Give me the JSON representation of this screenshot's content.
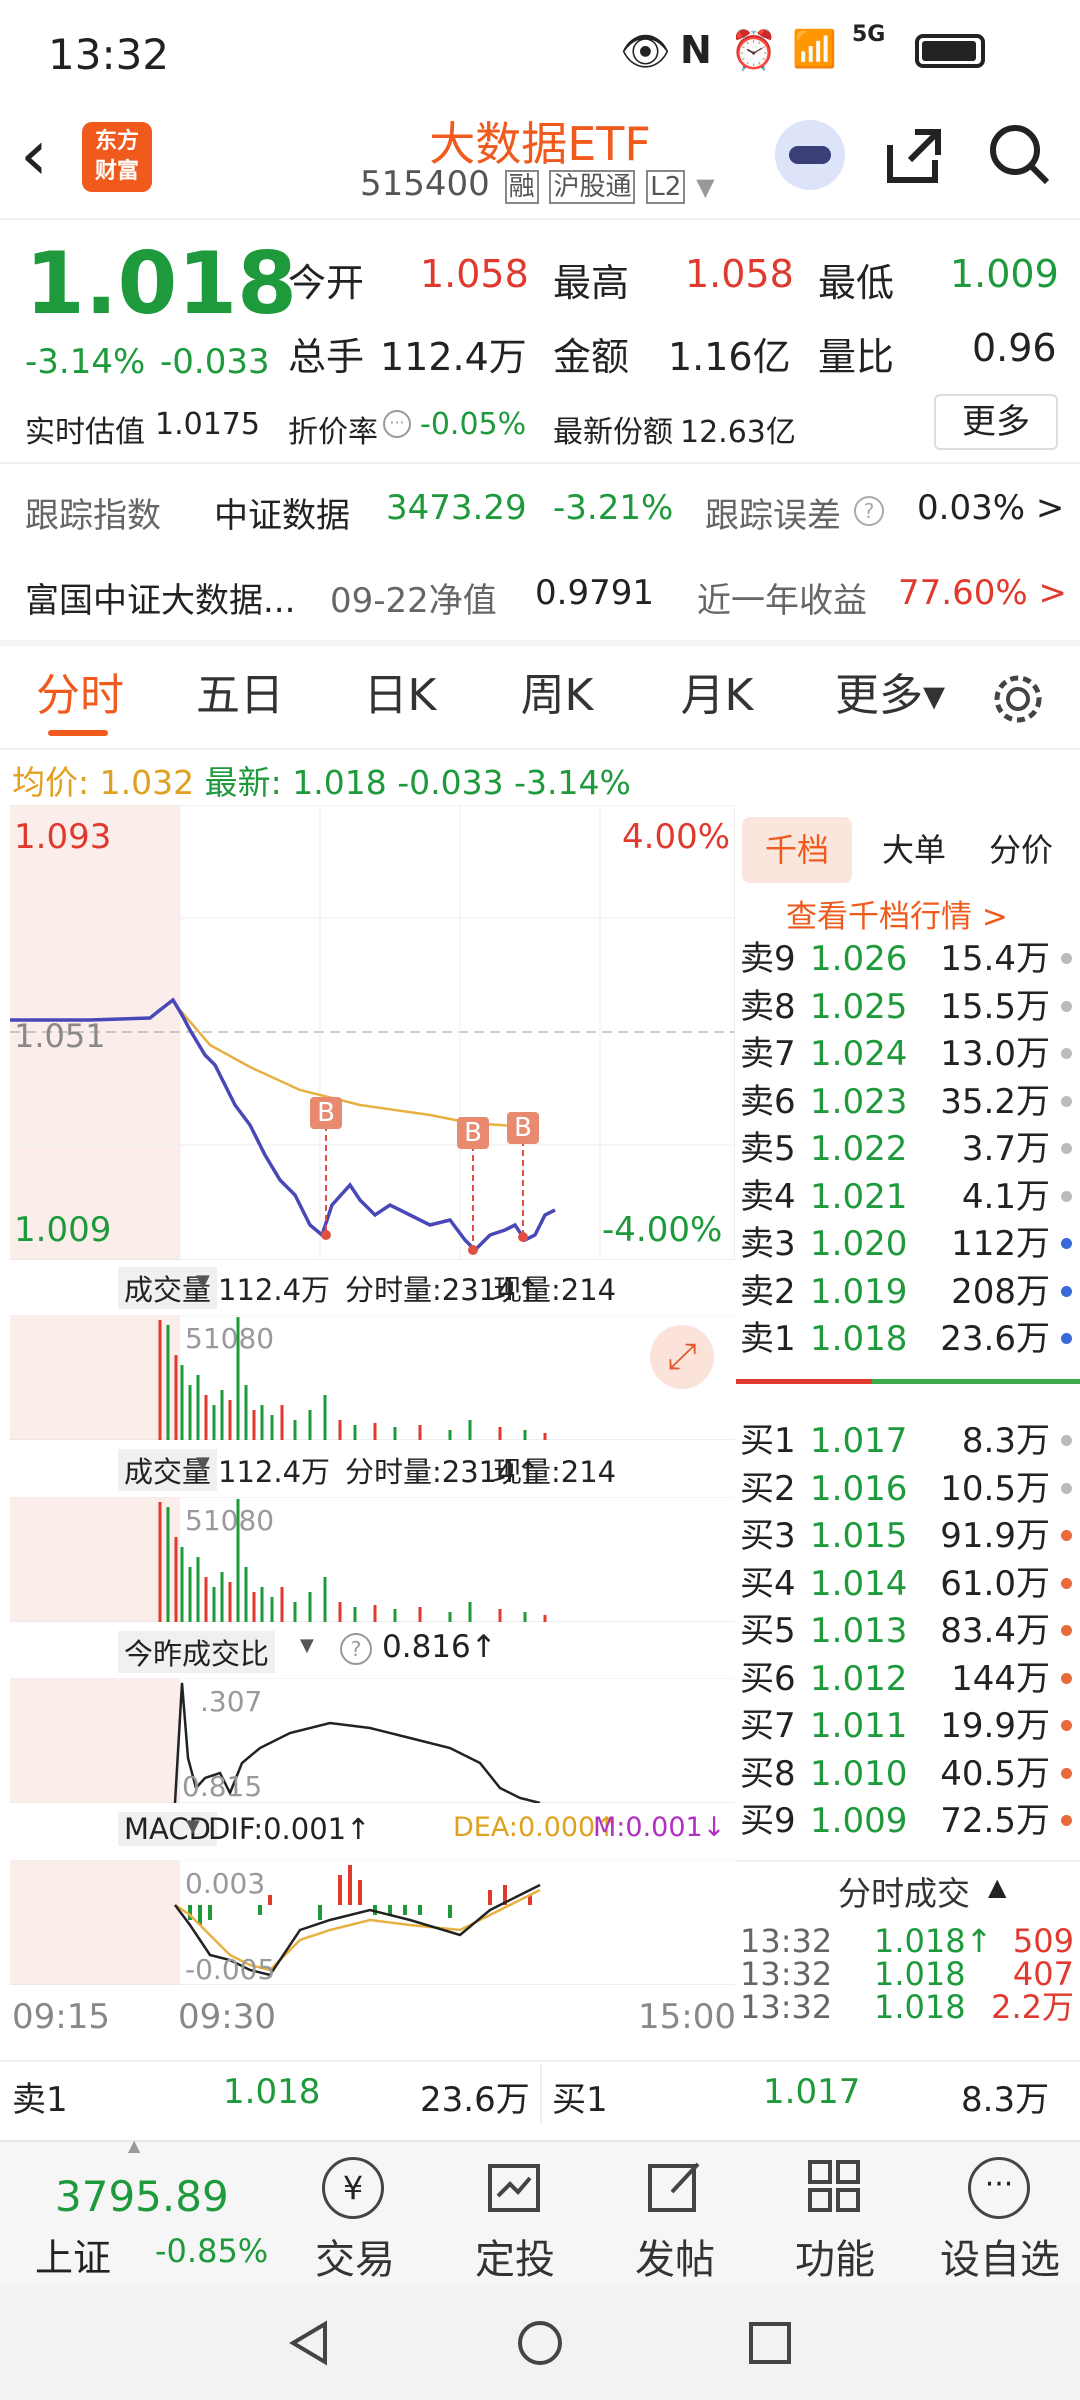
{
  "status": {
    "time": "13:32",
    "net": "5G"
  },
  "header": {
    "title": "大数据ETF",
    "code": "515400",
    "tag_rong": "融",
    "tag_hgt": "沪股通",
    "tag_l2": "L2",
    "logo_line1": "东方",
    "logo_line2": "财富"
  },
  "quote": {
    "price": "1.018",
    "pct": "-3.14%",
    "chg": "-0.033",
    "open_label": "今开",
    "open": "1.058",
    "high_label": "最高",
    "high": "1.058",
    "low_label": "最低",
    "low": "1.009",
    "vol_label": "总手",
    "vol": "112.4万",
    "amt_label": "金额",
    "amt": "1.16亿",
    "ratio_label": "量比",
    "ratio": "0.96",
    "est_label": "实时估值",
    "est": "1.0175",
    "disc_label": "折价率",
    "disc": "-0.05%",
    "share_label": "最新份额",
    "share": "12.63亿",
    "more": "更多"
  },
  "tracking": {
    "label": "跟踪指数",
    "index": "中证数据",
    "value": "3473.29",
    "pct": "-3.21%",
    "err_label": "跟踪误差",
    "err": "0.03% >"
  },
  "fund": {
    "name": "富国中证大数据...",
    "nav_date": "09-22净值",
    "nav": "0.9791",
    "ret_label": "近一年收益",
    "ret": "77.60% >"
  },
  "tabs": [
    "分时",
    "五日",
    "日K",
    "周K",
    "月K",
    "更多▾"
  ],
  "info": {
    "avg_label": "均价:",
    "avg": "1.032",
    "last_label": "最新:",
    "last": "1.018",
    "chg": "-0.033",
    "pct": "-3.14%"
  },
  "chart": {
    "y_top": "1.093",
    "y_mid": "1.051",
    "y_bot": "1.009",
    "pct_top": "4.00%",
    "pct_bot": "-4.00%",
    "vol_label": "成交量",
    "vol_total": "112.4万",
    "vol_time": "分时量:2314↑",
    "vol_now": "现量:214",
    "vol_max": "51080",
    "ratio_label": "今昨成交比",
    "ratio_val": "0.816↑",
    "ratio_top": ".307",
    "ratio_bot": "0.815",
    "macd_label": "MACD",
    "dif": "DIF:0.001↑",
    "dea": "DEA:0.000↑",
    "m": "M:0.001↓",
    "macd_top": "0.003",
    "macd_bot": "-0.005",
    "t_start": "09:15",
    "t_open": "09:30",
    "t_end": "15:00",
    "b_marker": "B"
  },
  "panel": {
    "tabs": [
      "千档",
      "大单",
      "分价"
    ],
    "link": "查看千档行情 >",
    "asks": [
      {
        "label": "卖9",
        "price": "1.026",
        "vol": "15.4万"
      },
      {
        "label": "卖8",
        "price": "1.025",
        "vol": "15.5万"
      },
      {
        "label": "卖7",
        "price": "1.024",
        "vol": "13.0万"
      },
      {
        "label": "卖6",
        "price": "1.023",
        "vol": "35.2万"
      },
      {
        "label": "卖5",
        "price": "1.022",
        "vol": "3.7万"
      },
      {
        "label": "卖4",
        "price": "1.021",
        "vol": "4.1万"
      },
      {
        "label": "卖3",
        "price": "1.020",
        "vol": "112万"
      },
      {
        "label": "卖2",
        "price": "1.019",
        "vol": "208万"
      },
      {
        "label": "卖1",
        "price": "1.018",
        "vol": "23.6万"
      }
    ],
    "bids": [
      {
        "label": "买1",
        "price": "1.017",
        "vol": "8.3万"
      },
      {
        "label": "买2",
        "price": "1.016",
        "vol": "10.5万"
      },
      {
        "label": "买3",
        "price": "1.015",
        "vol": "91.9万"
      },
      {
        "label": "买4",
        "price": "1.014",
        "vol": "61.0万"
      },
      {
        "label": "买5",
        "price": "1.013",
        "vol": "83.4万"
      },
      {
        "label": "买6",
        "price": "1.012",
        "vol": "144万"
      },
      {
        "label": "买7",
        "price": "1.011",
        "vol": "19.9万"
      },
      {
        "label": "买8",
        "price": "1.010",
        "vol": "40.5万"
      },
      {
        "label": "买9",
        "price": "1.009",
        "vol": "72.5万"
      }
    ],
    "trades_label": "分时成交",
    "trades": [
      {
        "time": "13:32",
        "price": "1.018↑",
        "vol": "509"
      },
      {
        "time": "13:32",
        "price": "1.018",
        "vol": "407"
      },
      {
        "time": "13:32",
        "price": "1.018",
        "vol": "2.2万"
      }
    ]
  },
  "best": {
    "ask_label": "卖1",
    "ask_price": "1.018",
    "ask_vol": "23.6万",
    "bid_label": "买1",
    "bid_price": "1.017",
    "bid_vol": "8.3万"
  },
  "bottom": {
    "index_val": "3795.89",
    "index_name": "上证",
    "index_pct": "-0.85%",
    "btns": [
      "交易",
      "定投",
      "发帖",
      "功能",
      "设自选"
    ]
  }
}
